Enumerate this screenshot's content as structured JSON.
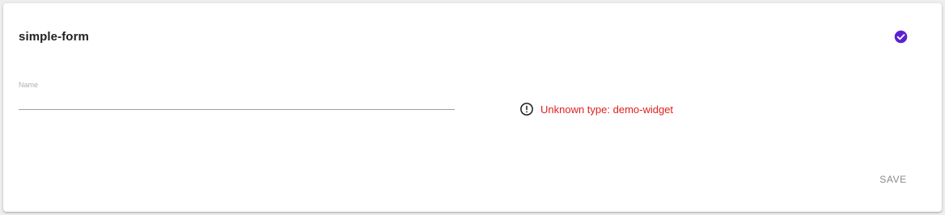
{
  "form": {
    "title": "simple-form",
    "status_icon": "check-circle-icon",
    "colors": {
      "accent": "#5b21d1",
      "error": "#e0201e"
    }
  },
  "fields": {
    "name": {
      "label": "Name",
      "value": ""
    }
  },
  "error": {
    "icon": "exclamation-circle-icon",
    "message": "Unknown type: demo-widget"
  },
  "actions": {
    "save_label": "SAVE"
  }
}
